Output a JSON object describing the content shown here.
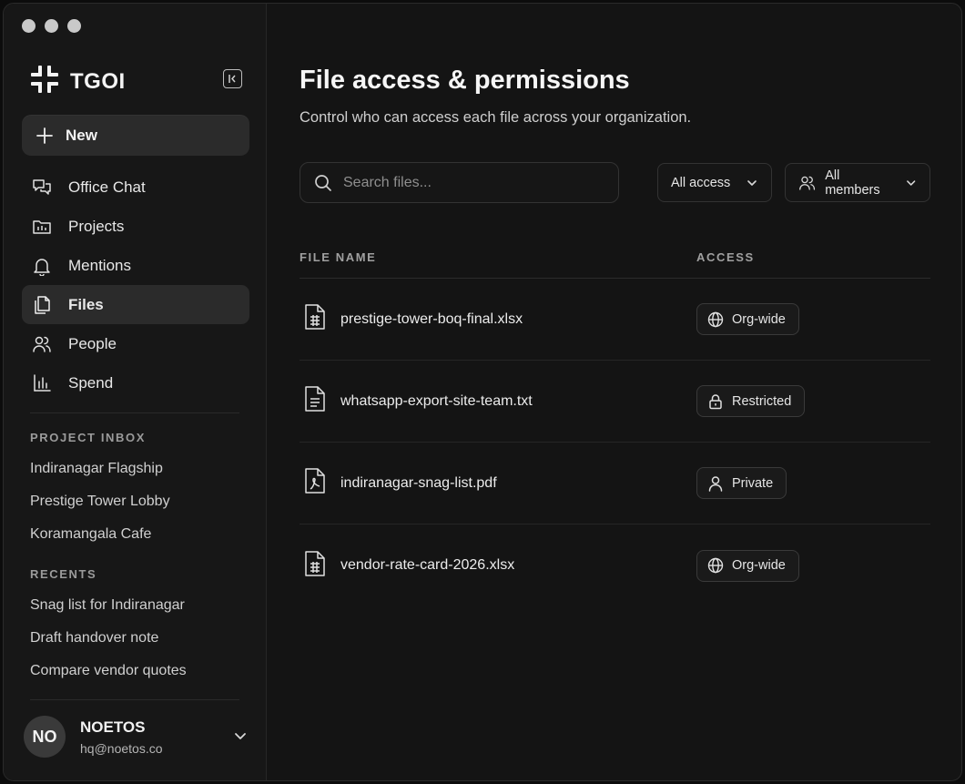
{
  "brand": {
    "name": "TGOI"
  },
  "sidebar": {
    "new_label": "New",
    "nav": [
      {
        "label": "Office Chat",
        "icon": "chat-icon",
        "active": false
      },
      {
        "label": "Projects",
        "icon": "projects-icon",
        "active": false
      },
      {
        "label": "Mentions",
        "icon": "bell-icon",
        "active": false
      },
      {
        "label": "Files",
        "icon": "files-icon",
        "active": true
      },
      {
        "label": "People",
        "icon": "people-icon",
        "active": false
      },
      {
        "label": "Spend",
        "icon": "chart-icon",
        "active": false
      }
    ],
    "project_inbox_title": "PROJECT INBOX",
    "project_inbox": [
      "Indiranagar Flagship",
      "Prestige Tower Lobby",
      "Koramangala Cafe"
    ],
    "recents_title": "RECENTS",
    "recents": [
      "Snag list for Indiranagar",
      "Draft handover note",
      "Compare vendor quotes"
    ]
  },
  "user": {
    "initials": "NO",
    "name": "NOETOS",
    "email": "hq@noetos.co"
  },
  "main": {
    "title": "File access & permissions",
    "subtitle": "Control who can access each file across your organization.",
    "search_placeholder": "Search files...",
    "filter_access": "All access",
    "filter_members": "All members",
    "columns": {
      "name": "FILE NAME",
      "access": "ACCESS"
    },
    "files": [
      {
        "name": "prestige-tower-boq-final.xlsx",
        "type": "spreadsheet",
        "access": "Org-wide",
        "access_icon": "globe-icon"
      },
      {
        "name": "whatsapp-export-site-team.txt",
        "type": "text",
        "access": "Restricted",
        "access_icon": "lock-icon"
      },
      {
        "name": "indiranagar-snag-list.pdf",
        "type": "pdf",
        "access": "Private",
        "access_icon": "person-icon"
      },
      {
        "name": "vendor-rate-card-2026.xlsx",
        "type": "spreadsheet",
        "access": "Org-wide",
        "access_icon": "globe-icon"
      }
    ]
  },
  "colors": {
    "background": "#141414",
    "sidebar": "#171717",
    "active": "#2b2b2b",
    "text": "#ececec"
  }
}
